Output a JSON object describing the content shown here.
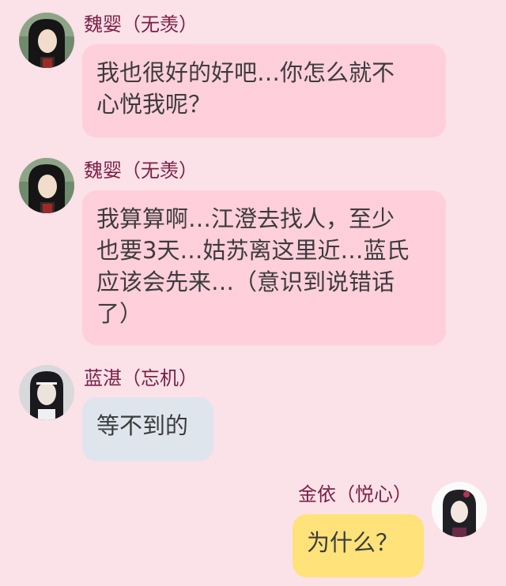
{
  "colors": {
    "background": "#fbe1e8",
    "name_text": "#7a1f45",
    "bubble_pink": "#ffcfdc",
    "bubble_blue": "#dfe5ec",
    "bubble_yellow": "#ffe27a"
  },
  "messages": [
    {
      "sender": "魏婴（无羡）",
      "avatar_icon": "wei-ying-avatar",
      "lines": [
        "我也很好的好吧…你怎么就不",
        "心悦我呢？"
      ]
    },
    {
      "sender": "魏婴（无羡）",
      "avatar_icon": "wei-ying-avatar",
      "lines": [
        "我算算啊…江澄去找人，至少",
        "也要3天…姑苏离这里近…蓝氏",
        "应该会先来…（意识到说错话",
        "了）"
      ]
    },
    {
      "sender": "蓝湛（忘机）",
      "avatar_icon": "lan-zhan-avatar",
      "lines": [
        "等不到的"
      ]
    },
    {
      "sender": "金依（悦心）",
      "avatar_icon": "jin-yi-avatar",
      "lines": [
        "为什么？"
      ]
    }
  ]
}
